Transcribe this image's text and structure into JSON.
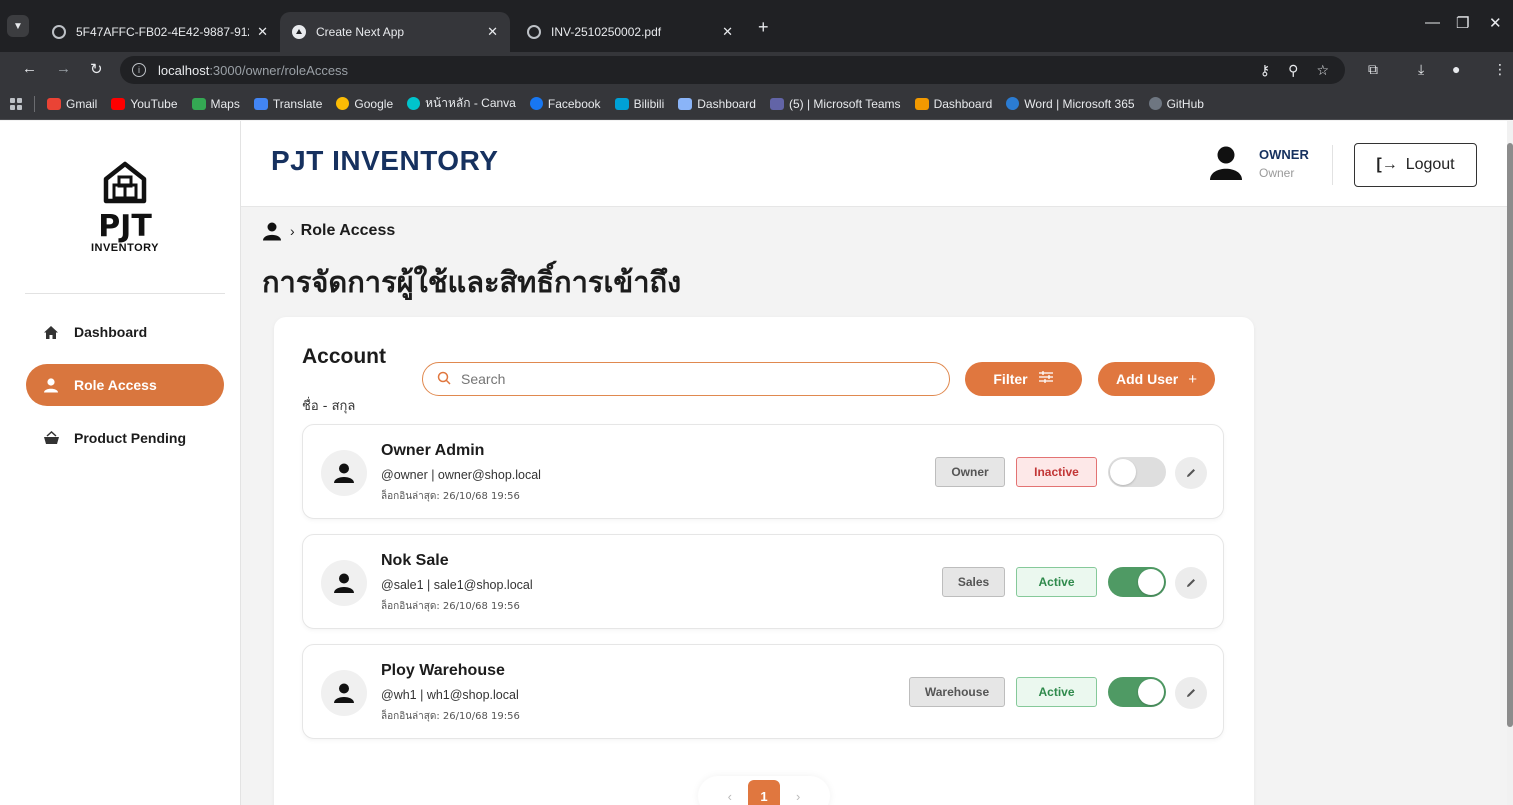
{
  "browser": {
    "tabs": [
      {
        "title": "5F47AFFC-FB02-4E42-9887-912",
        "active": false
      },
      {
        "title": "Create Next App",
        "active": true
      },
      {
        "title": "INV-2510250002.pdf",
        "active": false
      }
    ],
    "url_host": "localhost",
    "url_path": ":3000/owner/roleAccess",
    "bookmarks": [
      {
        "label": "Gmail",
        "color": "#ea4335"
      },
      {
        "label": "YouTube",
        "color": "#ff0000"
      },
      {
        "label": "Maps",
        "color": "#34a853"
      },
      {
        "label": "Translate",
        "color": "#4285f4"
      },
      {
        "label": "Google",
        "color": "#fbbc05"
      },
      {
        "label": "หน้าหลัก - Canva",
        "color": "#00c4cc"
      },
      {
        "label": "Facebook",
        "color": "#1877f2"
      },
      {
        "label": "Bilibili",
        "color": "#00a1d6"
      },
      {
        "label": "Dashboard",
        "color": "#8ab4f8"
      },
      {
        "label": "(5) | Microsoft Teams",
        "color": "#6264a7"
      },
      {
        "label": "Dashboard",
        "color": "#f29900"
      },
      {
        "label": "Word | Microsoft 365",
        "color": "#2b7cd3"
      },
      {
        "label": "GitHub",
        "color": "#6e7681"
      }
    ]
  },
  "sidebar": {
    "logo_word": "PJT",
    "logo_sub": "INVENTORY",
    "items": [
      {
        "label": "Dashboard",
        "icon": "home-icon",
        "active": false
      },
      {
        "label": "Role Access",
        "icon": "user-icon",
        "active": true
      },
      {
        "label": "Product Pending",
        "icon": "basket-icon",
        "active": false
      }
    ]
  },
  "header": {
    "title": "PJT INVENTORY",
    "user_name": "OWNER",
    "user_role": "Owner",
    "logout_label": "Logout"
  },
  "breadcrumb": {
    "current": "Role Access"
  },
  "page_title": "การจัดการผู้ใช้และสิทธิ์การเข้าถึง",
  "account": {
    "title": "Account",
    "subtitle": "ชื่อ - สกุล",
    "search_placeholder": "Search",
    "filter_label": "Filter",
    "add_user_label": "Add User"
  },
  "users": [
    {
      "name": "Owner Admin",
      "handle": "@owner | owner@shop.local",
      "last_login": "ล็อกอินล่าสุด: 26/10/68 19:56",
      "role": "Owner",
      "status": "Inactive",
      "enabled": false
    },
    {
      "name": "Nok Sale",
      "handle": "@sale1 | sale1@shop.local",
      "last_login": "ล็อกอินล่าสุด: 26/10/68 19:56",
      "role": "Sales",
      "status": "Active",
      "enabled": true
    },
    {
      "name": "Ploy Warehouse",
      "handle": "@wh1 | wh1@shop.local",
      "last_login": "ล็อกอินล่าสุด: 26/10/68 19:56",
      "role": "Warehouse",
      "status": "Active",
      "enabled": true
    }
  ],
  "pagination": {
    "current_page": "1"
  },
  "colors": {
    "accent": "#e0773f",
    "title_navy": "#16315f",
    "active_green": "#4f9a64",
    "inactive_red": "#c23636"
  }
}
